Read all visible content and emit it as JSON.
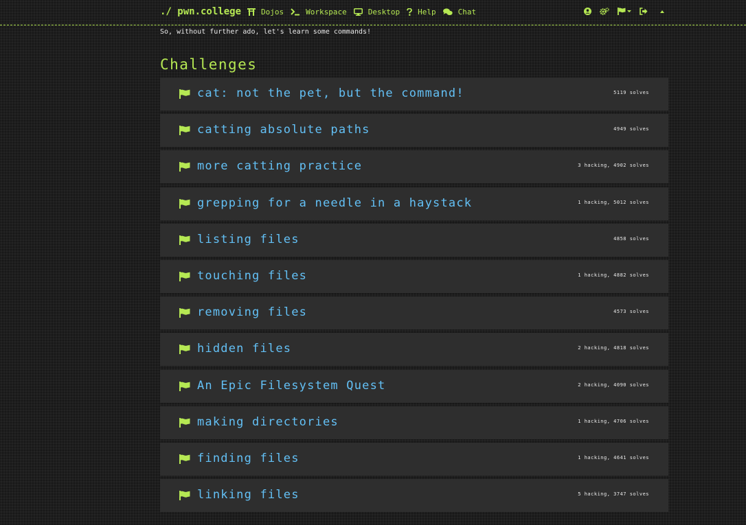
{
  "brand": "./ pwn.college",
  "nav": {
    "links": [
      {
        "label": "Dojos",
        "icon": "torii-gate-icon"
      },
      {
        "label": "Workspace",
        "icon": "terminal-icon"
      },
      {
        "label": "Desktop",
        "icon": "desktop-icon"
      },
      {
        "label": "Help",
        "icon": "question-icon"
      },
      {
        "label": "Chat",
        "icon": "comments-icon"
      }
    ],
    "right_icons": [
      "user-circle-icon",
      "cogs-icon",
      "flag-dropdown-icon",
      "sign-out-icon",
      "collapse-caret-icon"
    ]
  },
  "intro_text": "So, without further ado, let's learn some commands!",
  "section_title": "Challenges",
  "challenges": [
    {
      "title": "cat: not the pet, but the command!",
      "stats": "5119 solves"
    },
    {
      "title": "catting absolute paths",
      "stats": "4949 solves"
    },
    {
      "title": "more catting practice",
      "stats": "3 hacking, 4902 solves"
    },
    {
      "title": "grepping for a needle in a haystack",
      "stats": "1 hacking, 5012 solves"
    },
    {
      "title": "listing files",
      "stats": "4858 solves"
    },
    {
      "title": "touching files",
      "stats": "1 hacking, 4882 solves"
    },
    {
      "title": "removing files",
      "stats": "4573 solves"
    },
    {
      "title": "hidden files",
      "stats": "2 hacking, 4818 solves"
    },
    {
      "title": "An Epic Filesystem Quest",
      "stats": "2 hacking, 4090 solves"
    },
    {
      "title": "making directories",
      "stats": "1 hacking, 4706 solves"
    },
    {
      "title": "finding files",
      "stats": "1 hacking, 4641 solves"
    },
    {
      "title": "linking files",
      "stats": "5 hacking, 3747 solves"
    }
  ],
  "colors": {
    "accent": "#b5e853",
    "link": "#63c0f5",
    "background": "#1e1e1e",
    "card": "#2e2e2e",
    "text": "#eaeaea"
  }
}
